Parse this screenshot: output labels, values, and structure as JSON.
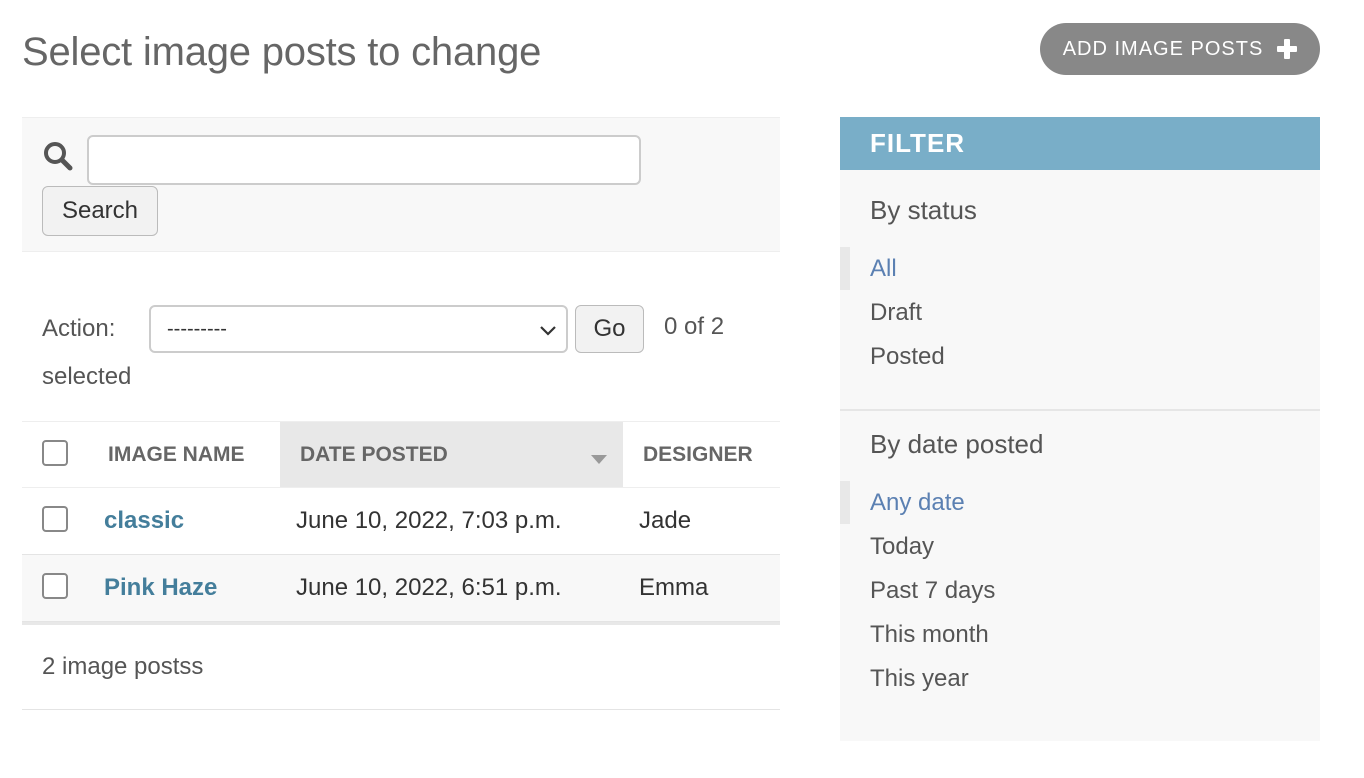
{
  "page": {
    "title": "Select image posts to change",
    "add_button_label": "ADD IMAGE POSTS"
  },
  "search": {
    "value": "",
    "placeholder": "",
    "button_label": "Search"
  },
  "actions": {
    "label": "Action:",
    "selected_option": "---------",
    "go_label": "Go",
    "counter_line1": "0 of 2",
    "counter_line2": "selected"
  },
  "table": {
    "columns": [
      "IMAGE NAME",
      "DATE POSTED",
      "DESIGNER"
    ],
    "sorted_column": "DATE POSTED",
    "rows": [
      {
        "image_name": "classic",
        "date_posted": "June 10, 2022, 7:03 p.m.",
        "designer": "Jade"
      },
      {
        "image_name": "Pink Haze",
        "date_posted": "June 10, 2022, 6:51 p.m.",
        "designer": "Emma"
      }
    ],
    "result_count": "2 image postss"
  },
  "filter": {
    "header": "FILTER",
    "groups": [
      {
        "title": "By status",
        "items": [
          "All",
          "Draft",
          "Posted"
        ],
        "selected": "All"
      },
      {
        "title": "By date posted",
        "items": [
          "Any date",
          "Today",
          "Past 7 days",
          "This month",
          "This year"
        ],
        "selected": "Any date"
      }
    ]
  },
  "colors": {
    "filter_header": "#79aec8",
    "link": "#447e9b",
    "selected_filter": "#5b80b2",
    "add_button": "#888888"
  }
}
